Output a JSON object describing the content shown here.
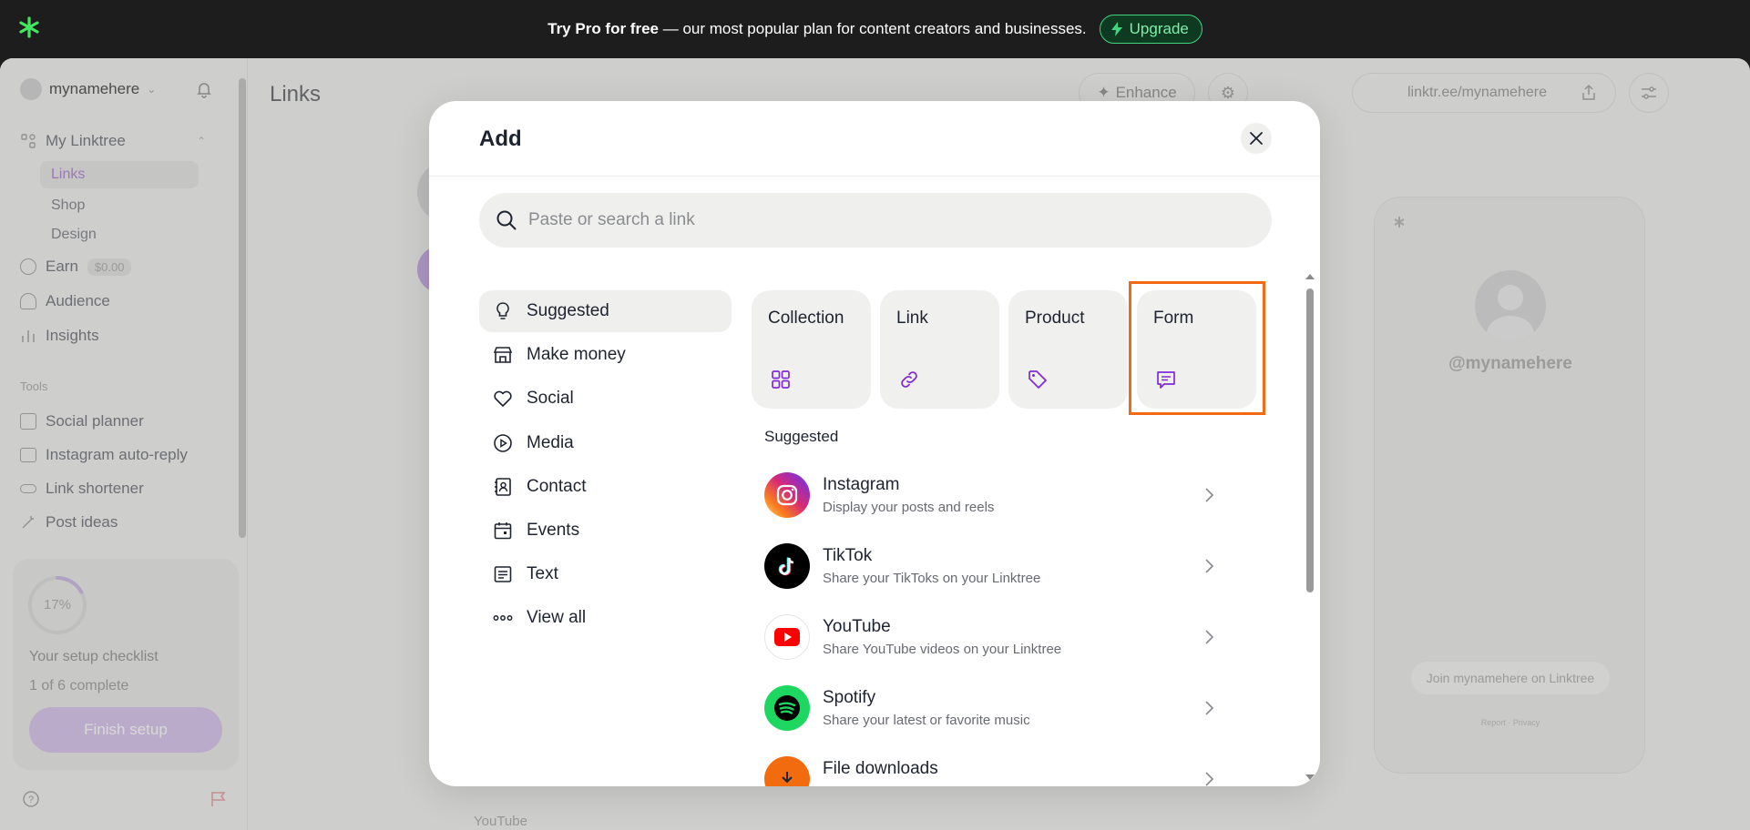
{
  "banner": {
    "bold": "Try Pro for free",
    "text": " — our most popular plan for content creators and businesses.",
    "upgrade_label": "Upgrade"
  },
  "sidebar": {
    "username": "mynamehere",
    "my_linktree": "My Linktree",
    "sub_items": [
      "Links",
      "Shop",
      "Design"
    ],
    "earn": "Earn",
    "earn_amount": "$0.00",
    "audience": "Audience",
    "insights": "Insights",
    "tools_heading": "Tools",
    "tools": [
      "Social planner",
      "Instagram auto-reply",
      "Link shortener",
      "Post ideas"
    ],
    "checklist": {
      "percent": "17%",
      "progress": 0.17,
      "title": "Your setup checklist",
      "subtitle": "1 of 6 complete",
      "button": "Finish setup"
    }
  },
  "main": {
    "title": "Links",
    "enhance": "Enhance",
    "bottom_label": "YouTube"
  },
  "preview": {
    "url": "linktr.ee/mynamehere",
    "handle": "@mynamehere",
    "join": "Join mynamehere on Linktree",
    "footer": "Report · Privacy"
  },
  "modal": {
    "title": "Add",
    "search_placeholder": "Paste or search a link",
    "categories": [
      {
        "label": "Suggested",
        "icon": "lightbulb-icon"
      },
      {
        "label": "Make money",
        "icon": "storefront-icon"
      },
      {
        "label": "Social",
        "icon": "heart-icon"
      },
      {
        "label": "Media",
        "icon": "play-icon"
      },
      {
        "label": "Contact",
        "icon": "contact-card-icon"
      },
      {
        "label": "Events",
        "icon": "calendar-icon"
      },
      {
        "label": "Text",
        "icon": "text-lines-icon"
      },
      {
        "label": "View all",
        "icon": "more-dots-icon"
      }
    ],
    "tiles": [
      {
        "label": "Collection",
        "icon": "grid-icon"
      },
      {
        "label": "Link",
        "icon": "link-icon"
      },
      {
        "label": "Product",
        "icon": "tag-icon"
      },
      {
        "label": "Form",
        "icon": "form-message-icon"
      }
    ],
    "suggested_heading": "Suggested",
    "suggestions": [
      {
        "name": "Instagram",
        "desc": "Display your posts and reels"
      },
      {
        "name": "TikTok",
        "desc": "Share your TikToks on your Linktree"
      },
      {
        "name": "YouTube",
        "desc": "Share YouTube videos on your Linktree"
      },
      {
        "name": "Spotify",
        "desc": "Share your latest or favorite music"
      },
      {
        "name": "File downloads",
        "desc": ""
      }
    ]
  },
  "colors": {
    "accent_purple": "#8129d9",
    "upgrade_green": "#3fd47d",
    "highlight_orange": "#f36a16",
    "youtube_red": "#ff0000",
    "spotify_green": "#1ed760"
  }
}
